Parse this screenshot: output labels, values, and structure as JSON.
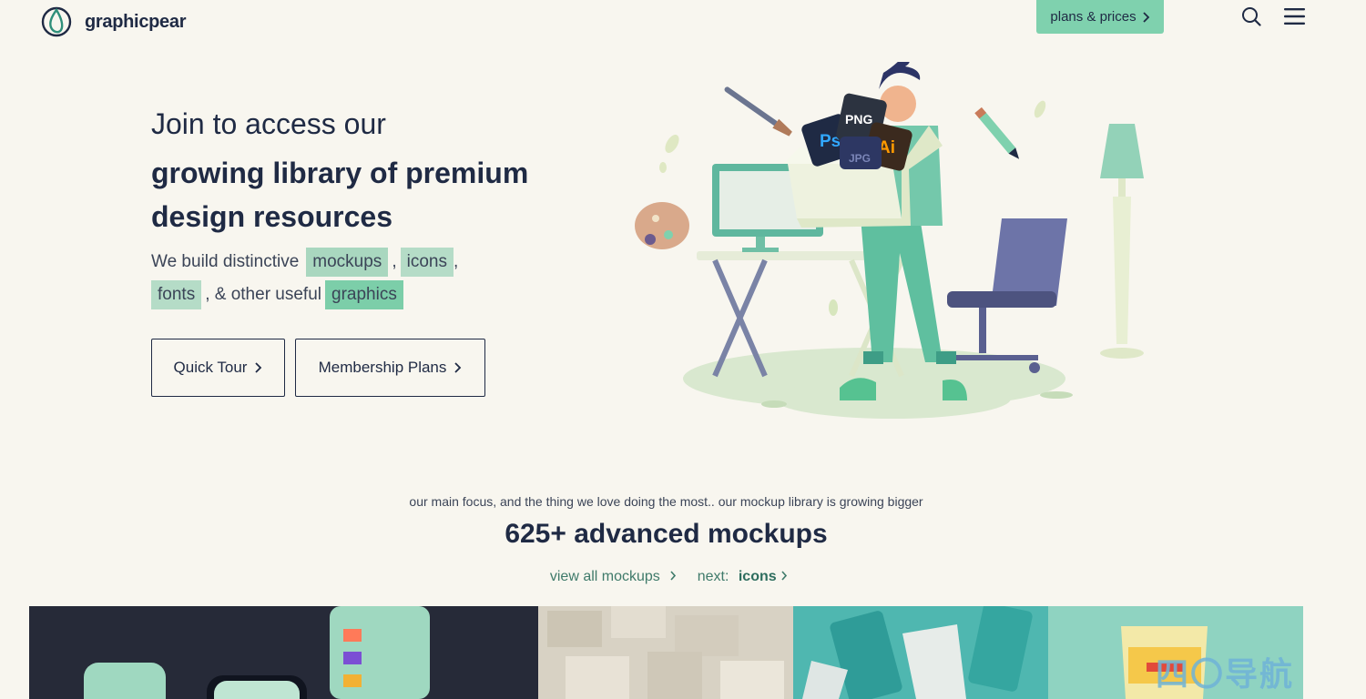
{
  "header": {
    "logo_text": "graphicpear",
    "plans_label": "plans & prices",
    "icons": [
      "logo-icon",
      "chevron-right-icon",
      "search-icon",
      "menu-icon"
    ]
  },
  "hero": {
    "title_light": "Join to access our",
    "title_bold": "growing library of premium design resources",
    "line1_prefix": "We build distinctive",
    "tag_mockups": "mockups",
    "comma1": ",",
    "tag_icons": "icons",
    "comma2": ",",
    "tag_fonts": "fonts",
    "line2_middle": ", & other useful",
    "tag_graphics": "graphics",
    "quick_tour_label": "Quick Tour",
    "membership_label": "Membership Plans",
    "illustration_badges": [
      "PNG",
      "Ps",
      "Ai",
      "JPG"
    ]
  },
  "mockups": {
    "focus_text": "our main focus, and the thing we love doing the most.. our mockup library is growing bigger",
    "count": "625+",
    "count_label": "advanced mockups",
    "view_all": "view all mockups",
    "next_prefix": "next:",
    "next_label": "icons",
    "watermark": "四〇导航"
  },
  "colors": {
    "background": "#f8f6ef",
    "accent_green": "#7fd1ae",
    "navy": "#1f2a44"
  }
}
